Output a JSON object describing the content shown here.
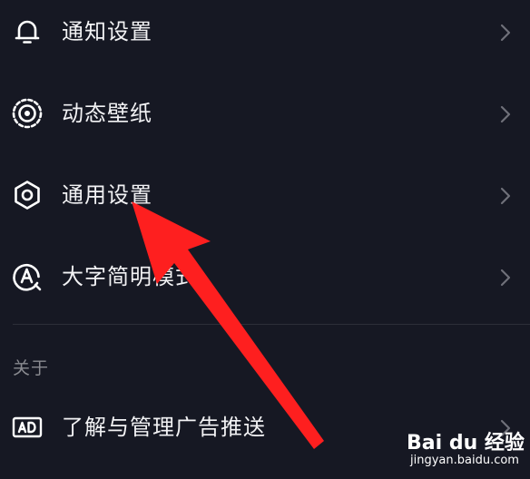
{
  "menu": {
    "items": [
      {
        "label": "通知设置",
        "icon": "bell-icon"
      },
      {
        "label": "动态壁纸",
        "icon": "live-wallpaper-icon"
      },
      {
        "label": "通用设置",
        "icon": "gear-icon"
      },
      {
        "label": "大字简明模式",
        "icon": "large-font-icon"
      }
    ]
  },
  "about_section": {
    "title": "关于",
    "items": [
      {
        "label": "了解与管理广告推送",
        "icon": "ad-icon"
      }
    ]
  },
  "watermark": {
    "brand": "Bai du 经验",
    "url": "jingyan.baidu.com"
  },
  "colors": {
    "background": "#161823",
    "text": "#f2f2f4",
    "muted_text": "#8a8b91",
    "chevron": "#6f7079",
    "annotation_arrow": "#fe1f1f"
  }
}
